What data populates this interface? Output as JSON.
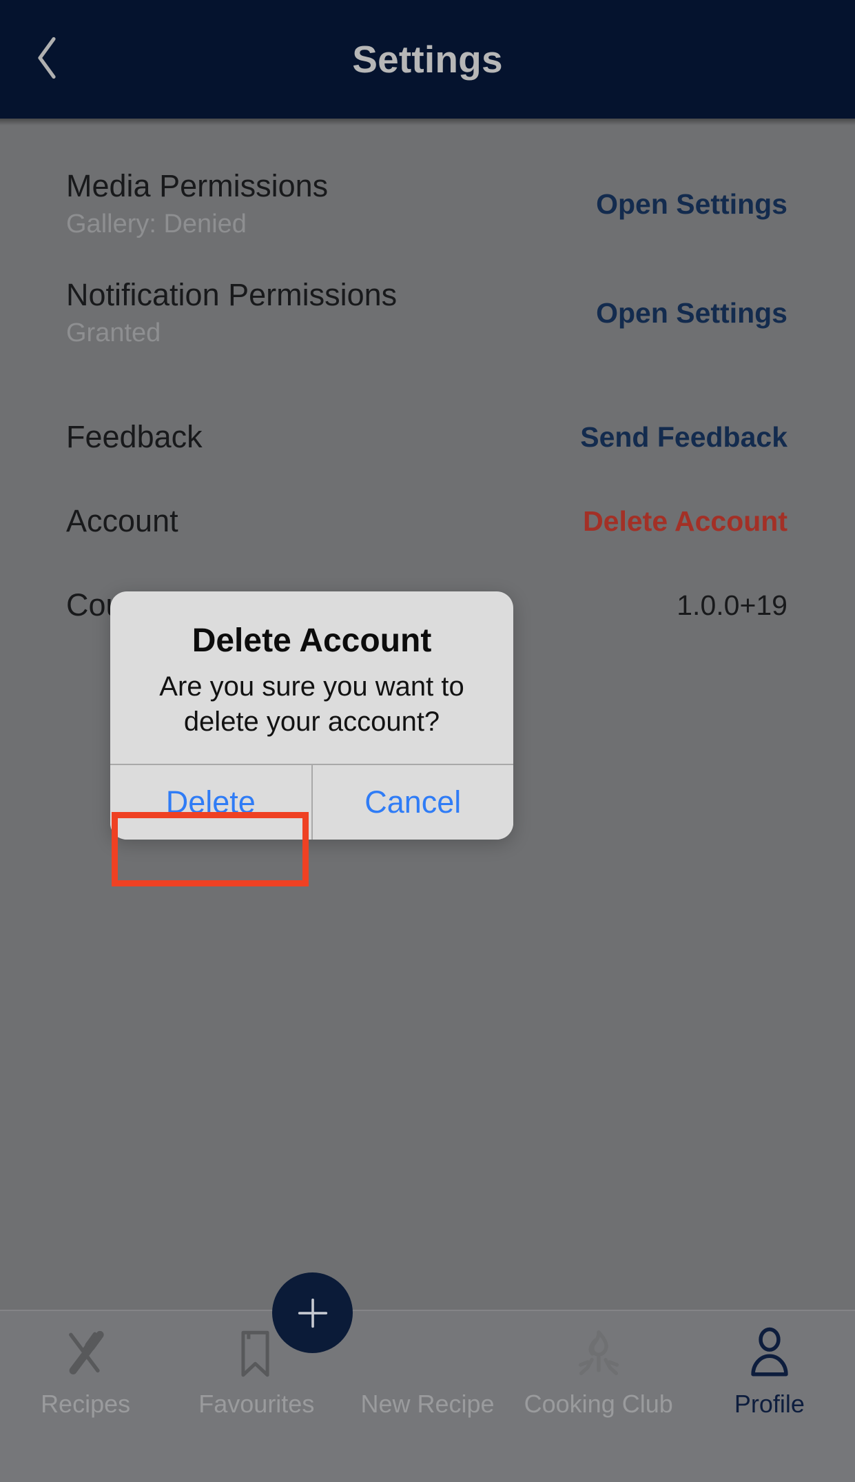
{
  "header": {
    "title": "Settings",
    "back_icon": "chevron-left-icon",
    "background_color": "#05132E",
    "title_color": "#B7B7B7"
  },
  "settings": {
    "rows": [
      {
        "id": "media-permissions",
        "title": "Media Permissions",
        "subtitle": "Gallery: Denied",
        "action": "Open Settings",
        "action_kind": "link"
      },
      {
        "id": "notification-permissions",
        "title": "Notification Permissions",
        "subtitle": "Granted",
        "action": "Open Settings",
        "action_kind": "link"
      },
      {
        "id": "feedback",
        "title": "Feedback",
        "subtitle": "",
        "action": "Send Feedback",
        "action_kind": "link"
      },
      {
        "id": "account",
        "title": "Account",
        "subtitle": "",
        "action": "Delete Account",
        "action_kind": "danger"
      },
      {
        "id": "app-version",
        "title": "Courtesy",
        "subtitle": "",
        "action": "1.0.0+19",
        "action_kind": "value"
      }
    ],
    "link_color": "#132B4E",
    "danger_color": "#A33026"
  },
  "dialog": {
    "title": "Delete Account",
    "message": "Are you sure you want to delete your account?",
    "confirm_label": "Delete",
    "cancel_label": "Cancel",
    "button_text_color": "#2F7CF6",
    "background_color": "#DCDCDC",
    "highlight_color": "#EF4123"
  },
  "bottom_nav": {
    "items": [
      {
        "id": "recipes",
        "label": "Recipes",
        "icon": "fork-knife-icon",
        "active": false
      },
      {
        "id": "favourites",
        "label": "Favourites",
        "icon": "bookmark-icon",
        "active": false
      },
      {
        "id": "new-recipe",
        "label": "New Recipe",
        "icon": "plus-icon",
        "active": false
      },
      {
        "id": "cooking-club",
        "label": "Cooking Club",
        "icon": "campfire-icon",
        "active": false
      },
      {
        "id": "profile",
        "label": "Profile",
        "icon": "person-icon",
        "active": true
      }
    ],
    "active_color": "#0D1D3D",
    "inactive_color": "#9A9B9D",
    "fab_color": "#0B1B38"
  }
}
